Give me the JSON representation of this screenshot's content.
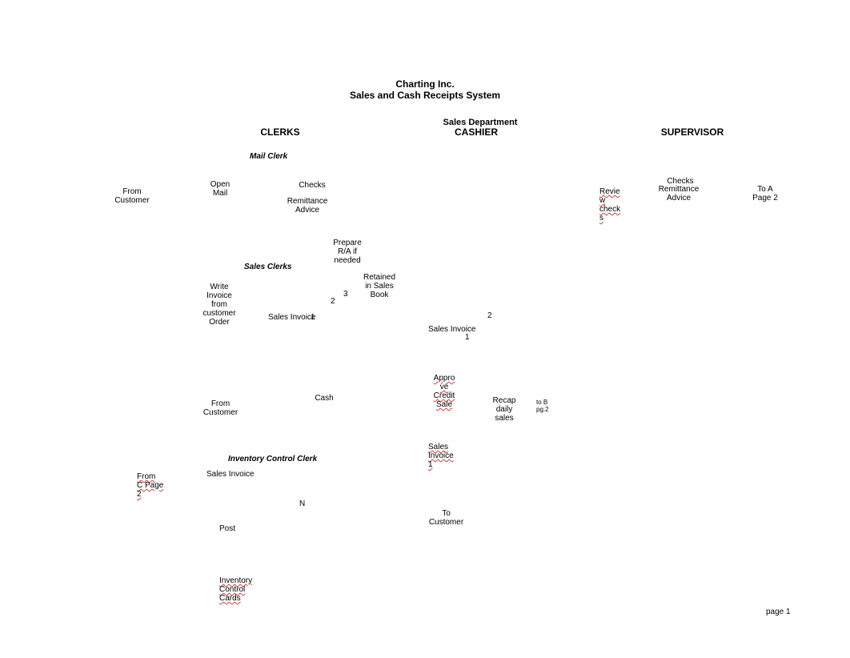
{
  "title": {
    "line1": "Charting Inc.",
    "line2": "Sales and Cash Receipts System"
  },
  "dept_header": "Sales Department",
  "columns": {
    "clerks": "CLERKS",
    "cashier": "CASHIER",
    "supervisor": "SUPERVISOR"
  },
  "subheads": {
    "mail_clerk": "Mail Clerk",
    "sales_clerks": "Sales Clerks",
    "inventory_control_clerk": "Inventory Control Clerk"
  },
  "mail_clerk": {
    "from_customer": "From\nCustomer",
    "open_mail": "Open\nMail",
    "checks": "Checks",
    "remittance_advice": "Remittance\nAdvice",
    "prepare_ra_needed": "Prepare\nR/A if\nneeded"
  },
  "sales_clerks": {
    "write_invoice": "Write\nInvoice\nfrom\ncustomer\nOrder",
    "sales_invoice_label": "Sales Invoice",
    "copy_1": "1",
    "copy_2": "2",
    "copy_3": "3",
    "retained_in_sales_book": "Retained\nin Sales\nBook",
    "from_customer": "From\nCustomer",
    "cash": "Cash"
  },
  "inventory_clerk": {
    "from_c_page_2": "From\nC Page\n2",
    "sales_invoice": "Sales Invoice",
    "n": "N",
    "post": "Post",
    "inventory_control_cards": "Inventory\nControl\nCards"
  },
  "cashier": {
    "sales_invoice": "Sales Invoice",
    "copy_1": "1",
    "copy_2": "2",
    "approve_credit_sale": "Appro\nve\nCredit\nSale",
    "recap_daily_sales": "Recap\ndaily\nsales",
    "to_b_pg2": "to B\npg.",
    "to_b_pg2_num": "2",
    "sales_invoice_1": "Sales\nInvoice 1",
    "to_customer": "To\nCustomer"
  },
  "supervisor": {
    "review_checks": "Revie\nw\ncheck\ns",
    "checks": "Checks",
    "remittance_advice": "Remittance\nAdvice",
    "to_a_page_2": "To A\nPage 2"
  },
  "footer": {
    "page": "page 1"
  }
}
